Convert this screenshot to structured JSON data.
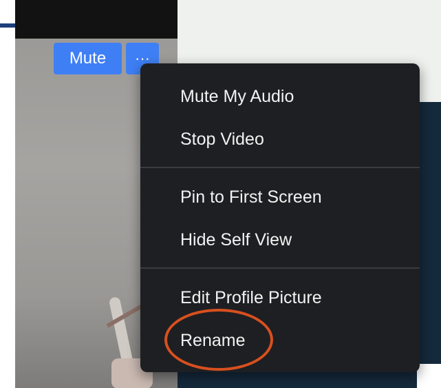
{
  "toolbar": {
    "mute_label": "Mute",
    "more_label": "···",
    "more_icon": "more-horizontal-icon"
  },
  "menu": {
    "items": [
      {
        "label": "Mute My Audio"
      },
      {
        "label": "Stop Video"
      },
      {
        "label": "Pin to First Screen"
      },
      {
        "label": "Hide Self View"
      },
      {
        "label": "Edit Profile Picture"
      },
      {
        "label": "Rename"
      }
    ]
  },
  "colors": {
    "accent_button": "#3f7ff5",
    "menu_background": "#1e1f22",
    "highlight_outline": "#d8501f"
  }
}
